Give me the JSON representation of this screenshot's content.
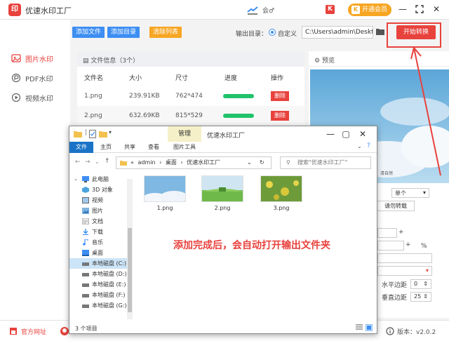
{
  "app": {
    "title": "优速水印工厂",
    "logo_text": "印",
    "center_text": "会♂",
    "h_icon": "K",
    "vip_label": "开通会员",
    "vip_icon": "K",
    "accent": "#e8423d"
  },
  "sidebar": {
    "items": [
      {
        "label": "图片水印",
        "icon": "image-watermark-icon",
        "active": true
      },
      {
        "label": "PDF水印",
        "icon": "pdf-icon",
        "active": false
      },
      {
        "label": "视频水印",
        "icon": "video-icon",
        "active": false
      }
    ]
  },
  "toolbar": {
    "add_file": "添加文件",
    "add_dir": "添加目录",
    "clear_list": "清除列表",
    "output_dir_label": "输出目录：",
    "custom_label": "自定义",
    "path_value": "C:\\Users\\admin\\Deskto",
    "start_button": "开始转换"
  },
  "file_panel": {
    "header": "文件信息（3个）",
    "columns": [
      "文件名",
      "大小",
      "尺寸",
      "进度",
      "操作"
    ],
    "rows": [
      {
        "name": "1.png",
        "size": "239.91KB",
        "dims": "762*474",
        "progress": 1.0,
        "action": "删除"
      },
      {
        "name": "2.png",
        "size": "632.69KB",
        "dims": "815*529",
        "progress": 1.0,
        "action": "删除"
      }
    ]
  },
  "preview": {
    "header": "预览",
    "watermark": "清自然"
  },
  "settings": {
    "select_single": "单个",
    "btn_transparent": "请勿转载",
    "percent_sign": "%",
    "h_margin_label": "水平边距",
    "h_margin_value": "0",
    "v_margin_label": "垂直边距",
    "v_margin_value": "25"
  },
  "bottom": {
    "site": "官方网址",
    "version": "版本：v2.0.2"
  },
  "explorer": {
    "ribbon_manage": "管理",
    "title": "优速水印工厂",
    "ribbon_tabs": [
      "文件",
      "主页",
      "共享",
      "查看",
      "图片工具"
    ],
    "address": [
      "«",
      "admin",
      "›",
      "桌面",
      "›",
      "优速水印工厂"
    ],
    "search_placeholder": "搜索\"优速水印工厂\"",
    "tree": [
      {
        "label": "此电脑",
        "icon": "computer-icon"
      },
      {
        "label": "3D 对象",
        "icon": "cube-icon"
      },
      {
        "label": "视频",
        "icon": "video-folder-icon"
      },
      {
        "label": "图片",
        "icon": "pictures-folder-icon"
      },
      {
        "label": "文档",
        "icon": "documents-folder-icon"
      },
      {
        "label": "下载",
        "icon": "download-icon"
      },
      {
        "label": "音乐",
        "icon": "music-icon"
      },
      {
        "label": "桌面",
        "icon": "desktop-folder-icon"
      },
      {
        "label": "本地磁盘 (C:)",
        "icon": "drive-icon",
        "selected": true
      },
      {
        "label": "本地磁盘 (D:)",
        "icon": "drive-icon"
      },
      {
        "label": "本地磁盘 (E:)",
        "icon": "drive-icon"
      },
      {
        "label": "本地磁盘 (F:)",
        "icon": "drive-icon"
      },
      {
        "label": "本地磁盘 (G:)",
        "icon": "drive-icon"
      }
    ],
    "files": [
      "1.png",
      "2.png",
      "3.png"
    ],
    "note": "添加完成后，会自动打开输出文件夹",
    "status": "3 个项目"
  }
}
